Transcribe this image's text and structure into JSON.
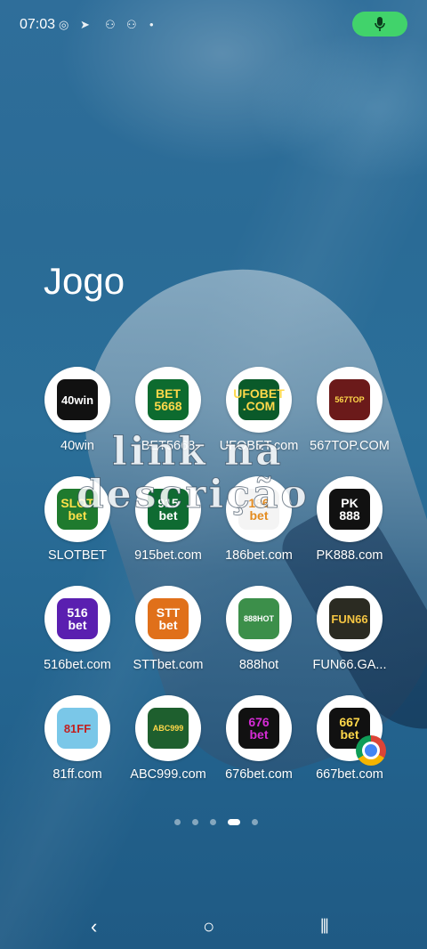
{
  "status_bar": {
    "time": "07:03",
    "icons": [
      "location-icon",
      "telegram-icon",
      "notification-icon",
      "notification-icon",
      "dot-icon"
    ],
    "mic_color": "#41d36b"
  },
  "folder": {
    "title": "Jogo"
  },
  "overlay": {
    "line1": "link na",
    "line2": "descrição"
  },
  "apps": [
    {
      "label": "40win",
      "icon_text": "40win",
      "bg": "#111111",
      "fg": "#ffffff"
    },
    {
      "label": "BET5668",
      "icon_text": "BET\n5668",
      "bg": "#0d6b2f",
      "fg": "#ffd84a"
    },
    {
      "label": "UFOBET.com",
      "icon_text": "UFOBET\n.COM",
      "bg": "#0a5a2a",
      "fg": "#ffd84a"
    },
    {
      "label": "567TOP.COM",
      "icon_text": "567TOP",
      "bg": "#6b1a1a",
      "fg": "#ffd84a"
    },
    {
      "label": "SLOTBET",
      "icon_text": "SLOT\nbet",
      "bg": "#1f7a2e",
      "fg": "#ffe14a"
    },
    {
      "label": "915bet.com",
      "icon_text": "915\nbet",
      "bg": "#0f6b32",
      "fg": "#ffffff"
    },
    {
      "label": "186bet.com",
      "icon_text": "186\nbet",
      "bg": "#f4f4f4",
      "fg": "#e38b1f"
    },
    {
      "label": "PK888.com",
      "icon_text": "PK\n888",
      "bg": "#111111",
      "fg": "#ffffff"
    },
    {
      "label": "516bet.com",
      "icon_text": "516\nbet",
      "bg": "#5a1fb0",
      "fg": "#ffffff"
    },
    {
      "label": "STTbet.com",
      "icon_text": "STT\nbet",
      "bg": "#e0701a",
      "fg": "#ffffff"
    },
    {
      "label": "888hot",
      "icon_text": "888HOT",
      "bg": "#3c8f4a",
      "fg": "#ffffff"
    },
    {
      "label": "FUN66.GA...",
      "icon_text": "FUN66",
      "bg": "#2b2b22",
      "fg": "#f5c542"
    },
    {
      "label": "81ff.com",
      "icon_text": "81FF",
      "bg": "#7ac7e8",
      "fg": "#c21f1f"
    },
    {
      "label": "ABC999.com",
      "icon_text": "ABC999",
      "bg": "#1e5f2e",
      "fg": "#ffd84a"
    },
    {
      "label": "676bet.com",
      "icon_text": "676\nbet",
      "bg": "#111111",
      "fg": "#d62bd6"
    },
    {
      "label": "667bet.com",
      "icon_text": "667\nbet",
      "bg": "#111111",
      "fg": "#ffd84a"
    }
  ],
  "pager": {
    "count": 5,
    "active_index": 3
  },
  "nav": {
    "back": "‹",
    "home": "○",
    "recents": "⦀"
  }
}
